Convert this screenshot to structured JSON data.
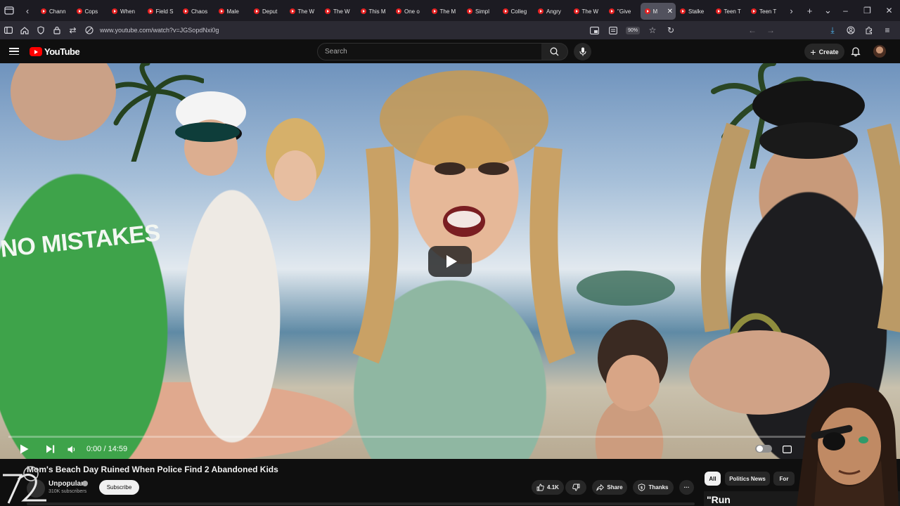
{
  "browser": {
    "tabs": [
      {
        "label": "Chann"
      },
      {
        "label": "Cops"
      },
      {
        "label": "When"
      },
      {
        "label": "Field S"
      },
      {
        "label": "Chaos"
      },
      {
        "label": "Male"
      },
      {
        "label": "Deput"
      },
      {
        "label": "The W"
      },
      {
        "label": "The W"
      },
      {
        "label": "This M"
      },
      {
        "label": "One o"
      },
      {
        "label": "The M"
      },
      {
        "label": "Simpl"
      },
      {
        "label": "Colleg"
      },
      {
        "label": "Angry"
      },
      {
        "label": "The W"
      },
      {
        "label": "\"Give"
      },
      {
        "label": "M",
        "active": true
      },
      {
        "label": "Stalke"
      },
      {
        "label": "Teen T"
      },
      {
        "label": "Teen T"
      }
    ],
    "url": "www.youtube.com/watch?v=JGSopdNxi0g",
    "zoom": "90%"
  },
  "youtube": {
    "logo_text": "YouTube",
    "search_placeholder": "Search",
    "create_label": "Create"
  },
  "video": {
    "shirt_text": "NO MISTAKES",
    "time": "0:00 / 14:59",
    "progress": 0
  },
  "meta": {
    "title": "Mom's Beach Day Ruined When Police Find 2 Abandoned Kids",
    "channel": "Unpopular",
    "subscribers": "310K subscribers",
    "subscribe_label": "Subscribe",
    "likes": "4.1K",
    "share_label": "Share",
    "thanks_label": "Thanks",
    "more_label": "···"
  },
  "chips": [
    {
      "label": "All",
      "selected": true
    },
    {
      "label": "Politics News"
    },
    {
      "label": "For"
    }
  ],
  "overlay": {
    "thumb_text": "\"Run"
  }
}
